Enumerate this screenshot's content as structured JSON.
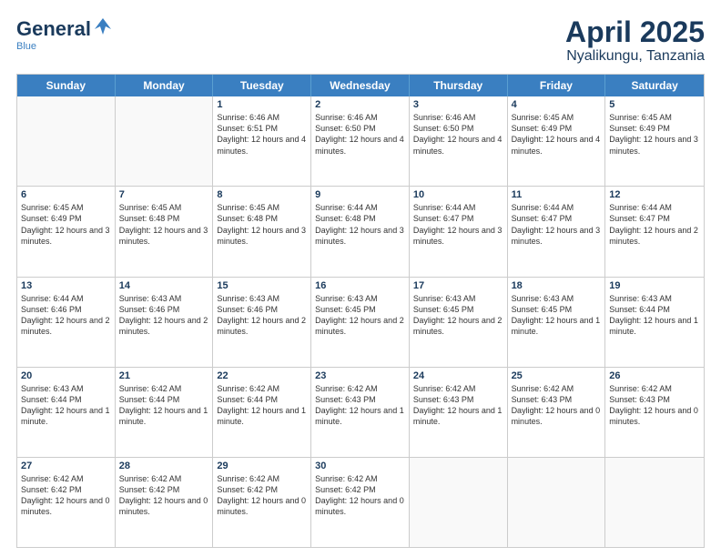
{
  "logo": {
    "general": "General",
    "blue": "Blue",
    "bird": "▲"
  },
  "title": "April 2025",
  "subtitle": "Nyalikungu, Tanzania",
  "header_days": [
    "Sunday",
    "Monday",
    "Tuesday",
    "Wednesday",
    "Thursday",
    "Friday",
    "Saturday"
  ],
  "weeks": [
    [
      {
        "day": "",
        "sunrise": "",
        "sunset": "",
        "daylight": ""
      },
      {
        "day": "",
        "sunrise": "",
        "sunset": "",
        "daylight": ""
      },
      {
        "day": "1",
        "sunrise": "Sunrise: 6:46 AM",
        "sunset": "Sunset: 6:51 PM",
        "daylight": "Daylight: 12 hours and 4 minutes."
      },
      {
        "day": "2",
        "sunrise": "Sunrise: 6:46 AM",
        "sunset": "Sunset: 6:50 PM",
        "daylight": "Daylight: 12 hours and 4 minutes."
      },
      {
        "day": "3",
        "sunrise": "Sunrise: 6:46 AM",
        "sunset": "Sunset: 6:50 PM",
        "daylight": "Daylight: 12 hours and 4 minutes."
      },
      {
        "day": "4",
        "sunrise": "Sunrise: 6:45 AM",
        "sunset": "Sunset: 6:49 PM",
        "daylight": "Daylight: 12 hours and 4 minutes."
      },
      {
        "day": "5",
        "sunrise": "Sunrise: 6:45 AM",
        "sunset": "Sunset: 6:49 PM",
        "daylight": "Daylight: 12 hours and 3 minutes."
      }
    ],
    [
      {
        "day": "6",
        "sunrise": "Sunrise: 6:45 AM",
        "sunset": "Sunset: 6:49 PM",
        "daylight": "Daylight: 12 hours and 3 minutes."
      },
      {
        "day": "7",
        "sunrise": "Sunrise: 6:45 AM",
        "sunset": "Sunset: 6:48 PM",
        "daylight": "Daylight: 12 hours and 3 minutes."
      },
      {
        "day": "8",
        "sunrise": "Sunrise: 6:45 AM",
        "sunset": "Sunset: 6:48 PM",
        "daylight": "Daylight: 12 hours and 3 minutes."
      },
      {
        "day": "9",
        "sunrise": "Sunrise: 6:44 AM",
        "sunset": "Sunset: 6:48 PM",
        "daylight": "Daylight: 12 hours and 3 minutes."
      },
      {
        "day": "10",
        "sunrise": "Sunrise: 6:44 AM",
        "sunset": "Sunset: 6:47 PM",
        "daylight": "Daylight: 12 hours and 3 minutes."
      },
      {
        "day": "11",
        "sunrise": "Sunrise: 6:44 AM",
        "sunset": "Sunset: 6:47 PM",
        "daylight": "Daylight: 12 hours and 3 minutes."
      },
      {
        "day": "12",
        "sunrise": "Sunrise: 6:44 AM",
        "sunset": "Sunset: 6:47 PM",
        "daylight": "Daylight: 12 hours and 2 minutes."
      }
    ],
    [
      {
        "day": "13",
        "sunrise": "Sunrise: 6:44 AM",
        "sunset": "Sunset: 6:46 PM",
        "daylight": "Daylight: 12 hours and 2 minutes."
      },
      {
        "day": "14",
        "sunrise": "Sunrise: 6:43 AM",
        "sunset": "Sunset: 6:46 PM",
        "daylight": "Daylight: 12 hours and 2 minutes."
      },
      {
        "day": "15",
        "sunrise": "Sunrise: 6:43 AM",
        "sunset": "Sunset: 6:46 PM",
        "daylight": "Daylight: 12 hours and 2 minutes."
      },
      {
        "day": "16",
        "sunrise": "Sunrise: 6:43 AM",
        "sunset": "Sunset: 6:45 PM",
        "daylight": "Daylight: 12 hours and 2 minutes."
      },
      {
        "day": "17",
        "sunrise": "Sunrise: 6:43 AM",
        "sunset": "Sunset: 6:45 PM",
        "daylight": "Daylight: 12 hours and 2 minutes."
      },
      {
        "day": "18",
        "sunrise": "Sunrise: 6:43 AM",
        "sunset": "Sunset: 6:45 PM",
        "daylight": "Daylight: 12 hours and 1 minute."
      },
      {
        "day": "19",
        "sunrise": "Sunrise: 6:43 AM",
        "sunset": "Sunset: 6:44 PM",
        "daylight": "Daylight: 12 hours and 1 minute."
      }
    ],
    [
      {
        "day": "20",
        "sunrise": "Sunrise: 6:43 AM",
        "sunset": "Sunset: 6:44 PM",
        "daylight": "Daylight: 12 hours and 1 minute."
      },
      {
        "day": "21",
        "sunrise": "Sunrise: 6:42 AM",
        "sunset": "Sunset: 6:44 PM",
        "daylight": "Daylight: 12 hours and 1 minute."
      },
      {
        "day": "22",
        "sunrise": "Sunrise: 6:42 AM",
        "sunset": "Sunset: 6:44 PM",
        "daylight": "Daylight: 12 hours and 1 minute."
      },
      {
        "day": "23",
        "sunrise": "Sunrise: 6:42 AM",
        "sunset": "Sunset: 6:43 PM",
        "daylight": "Daylight: 12 hours and 1 minute."
      },
      {
        "day": "24",
        "sunrise": "Sunrise: 6:42 AM",
        "sunset": "Sunset: 6:43 PM",
        "daylight": "Daylight: 12 hours and 1 minute."
      },
      {
        "day": "25",
        "sunrise": "Sunrise: 6:42 AM",
        "sunset": "Sunset: 6:43 PM",
        "daylight": "Daylight: 12 hours and 0 minutes."
      },
      {
        "day": "26",
        "sunrise": "Sunrise: 6:42 AM",
        "sunset": "Sunset: 6:43 PM",
        "daylight": "Daylight: 12 hours and 0 minutes."
      }
    ],
    [
      {
        "day": "27",
        "sunrise": "Sunrise: 6:42 AM",
        "sunset": "Sunset: 6:42 PM",
        "daylight": "Daylight: 12 hours and 0 minutes."
      },
      {
        "day": "28",
        "sunrise": "Sunrise: 6:42 AM",
        "sunset": "Sunset: 6:42 PM",
        "daylight": "Daylight: 12 hours and 0 minutes."
      },
      {
        "day": "29",
        "sunrise": "Sunrise: 6:42 AM",
        "sunset": "Sunset: 6:42 PM",
        "daylight": "Daylight: 12 hours and 0 minutes."
      },
      {
        "day": "30",
        "sunrise": "Sunrise: 6:42 AM",
        "sunset": "Sunset: 6:42 PM",
        "daylight": "Daylight: 12 hours and 0 minutes."
      },
      {
        "day": "",
        "sunrise": "",
        "sunset": "",
        "daylight": ""
      },
      {
        "day": "",
        "sunrise": "",
        "sunset": "",
        "daylight": ""
      },
      {
        "day": "",
        "sunrise": "",
        "sunset": "",
        "daylight": ""
      }
    ]
  ]
}
